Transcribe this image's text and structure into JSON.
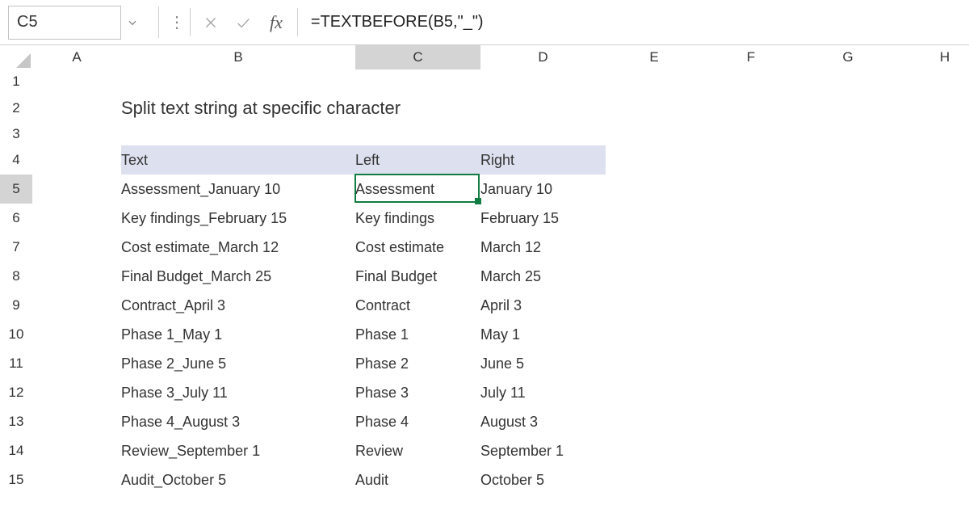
{
  "name_box": {
    "value": "C5"
  },
  "fx_label": "fx",
  "formula": "=TEXTBEFORE(B5,\"_\")",
  "columns": [
    "A",
    "B",
    "C",
    "D",
    "E",
    "F",
    "G",
    "H"
  ],
  "active_col": "C",
  "active_row": "5",
  "rows": [
    "1",
    "2",
    "3",
    "4",
    "5",
    "6",
    "7",
    "8",
    "9",
    "10",
    "11",
    "12",
    "13",
    "14",
    "15"
  ],
  "title": "Split text string at specific character",
  "table": {
    "headers": {
      "text": "Text",
      "left": "Left",
      "right": "Right"
    },
    "data": [
      {
        "text": "Assessment_January 10",
        "left": "Assessment",
        "right": "January 10"
      },
      {
        "text": "Key findings_February 15",
        "left": "Key findings",
        "right": "February 15"
      },
      {
        "text": "Cost estimate_March 12",
        "left": "Cost estimate",
        "right": "March 12"
      },
      {
        "text": "Final Budget_March 25",
        "left": "Final Budget",
        "right": "March 25"
      },
      {
        "text": "Contract_April 3",
        "left": "Contract",
        "right": "April 3"
      },
      {
        "text": "Phase 1_May 1",
        "left": "Phase 1",
        "right": "May 1"
      },
      {
        "text": "Phase 2_June 5",
        "left": "Phase 2",
        "right": "June 5"
      },
      {
        "text": "Phase 3_July 11",
        "left": "Phase 3",
        "right": "July 11"
      },
      {
        "text": "Phase 4_August 3",
        "left": "Phase 4",
        "right": "August 3"
      },
      {
        "text": "Review_September 1",
        "left": "Review",
        "right": "September 1"
      },
      {
        "text": "Audit_October 5",
        "left": "Audit",
        "right": "October 5"
      }
    ]
  }
}
